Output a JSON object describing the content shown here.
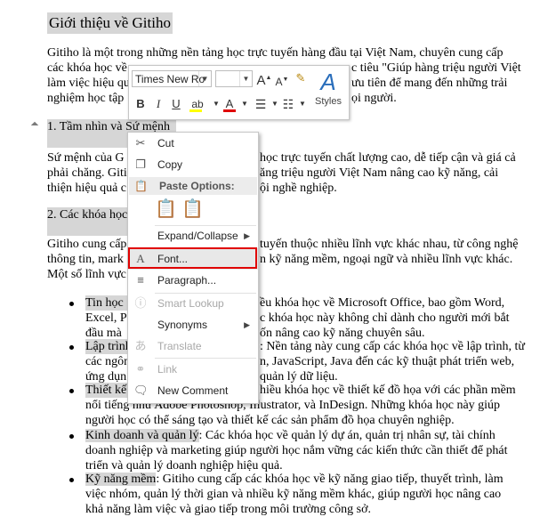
{
  "document": {
    "title": "Giới thiệu về Gitiho",
    "intro_lines": [
      "Gitiho là một trong những nền tảng học trực tuyến hàng đầu tại Việt Nam, chuyên cung cấp",
      "các khóa học về",
      "làm việc hiệu qu",
      "nghiệm học tập"
    ],
    "intro_tail": [
      "c tiêu \"Giúp hàng triệu người Việt",
      "ưu tiên để mang đến những trải",
      "ọi người."
    ],
    "heading1": "1. Tầm nhìn và Sứ mệnh",
    "mission_lines": [
      "Sứ mệnh của G",
      "phải chăng. Giti",
      "thiện hiệu quả c"
    ],
    "mission_tail": [
      "học trực tuyến chất lượng cao, dễ tiếp cận và giá cả",
      "ăng triệu người Việt Nam nâng cao kỹ năng, cải",
      "ội nghề nghiệp."
    ],
    "heading2": "2. Các khóa học",
    "courses_lines": [
      "Gitiho cung cấp",
      "thông tin, mark",
      "Một số lĩnh vực"
    ],
    "courses_tail": [
      "tuyến thuộc nhiều lĩnh vực khác nhau, từ công nghệ",
      "n kỹ năng mềm, ngoại ngữ và nhiều lĩnh vực khác."
    ],
    "bullets": {
      "b1_head": "Tin học",
      "b1_tail": [
        "ều khóa học về Microsoft Office, bao gồm Word,",
        "c khóa học này không chỉ dành cho người mới bắt",
        "ốn nâng cao kỹ năng chuyên sâu."
      ],
      "b1_left": [
        "Excel, P",
        "đầu mà"
      ],
      "b2_head": "Lập trình",
      "b2_tail": [
        ": Nền tảng này cung cấp các khóa học về lập trình, từ",
        "n, JavaScript, Java đến các kỹ thuật phát triển web,",
        "quản lý dữ liệu."
      ],
      "b2_left": [
        "các ngôn",
        "ứng dụn"
      ],
      "b3_head": "Thiết kế",
      "b3_tail": [
        "hiều khóa học về thiết kế đồ họa với các phần mềm"
      ],
      "b3_lines": [
        "nổi tiếng như Adobe Photoshop, Illustrator, và InDesign. Những khóa học này giúp",
        "người học có thể sáng tạo và thiết kế các sản phẩm đồ họa chuyên nghiệp."
      ],
      "b4_head": "Kinh doanh và quản lý",
      "b4_rest": ": Các khóa học về quản lý dự án, quản trị nhân sự, tài chính",
      "b4_lines": [
        "doanh nghiệp và marketing giúp người học nắm vững các kiến thức cần thiết để phát",
        "triển và quản lý doanh nghiệp hiệu quả."
      ],
      "b5_head": "Kỹ năng mềm",
      "b5_rest": ": Gitiho cung cấp các khóa học về kỹ năng giao tiếp, thuyết trình, làm",
      "b5_lines": [
        "việc nhóm, quản lý thời gian và nhiều kỹ năng mềm khác, giúp người học nâng cao",
        "khả năng làm việc và giao tiếp trong môi trường công sở."
      ]
    }
  },
  "mini_toolbar": {
    "font_name": "Times New Ro",
    "font_size": "",
    "styles_label": "Styles",
    "grow_font": "A",
    "shrink_font": "A",
    "bold": "B",
    "italic": "I",
    "underline": "U",
    "font_color": "A",
    "styles_glyph": "A"
  },
  "context_menu": {
    "items": {
      "cut": "Cut",
      "copy": "Copy",
      "paste_options": "Paste Options:",
      "expand_collapse": "Expand/Collapse",
      "font": "Font...",
      "paragraph": "Paragraph...",
      "smart_lookup": "Smart Lookup",
      "synonyms": "Synonyms",
      "translate": "Translate",
      "link": "Link",
      "new_comment": "New Comment"
    },
    "highlighted_item": "font",
    "highlight_color": "#e00000"
  }
}
